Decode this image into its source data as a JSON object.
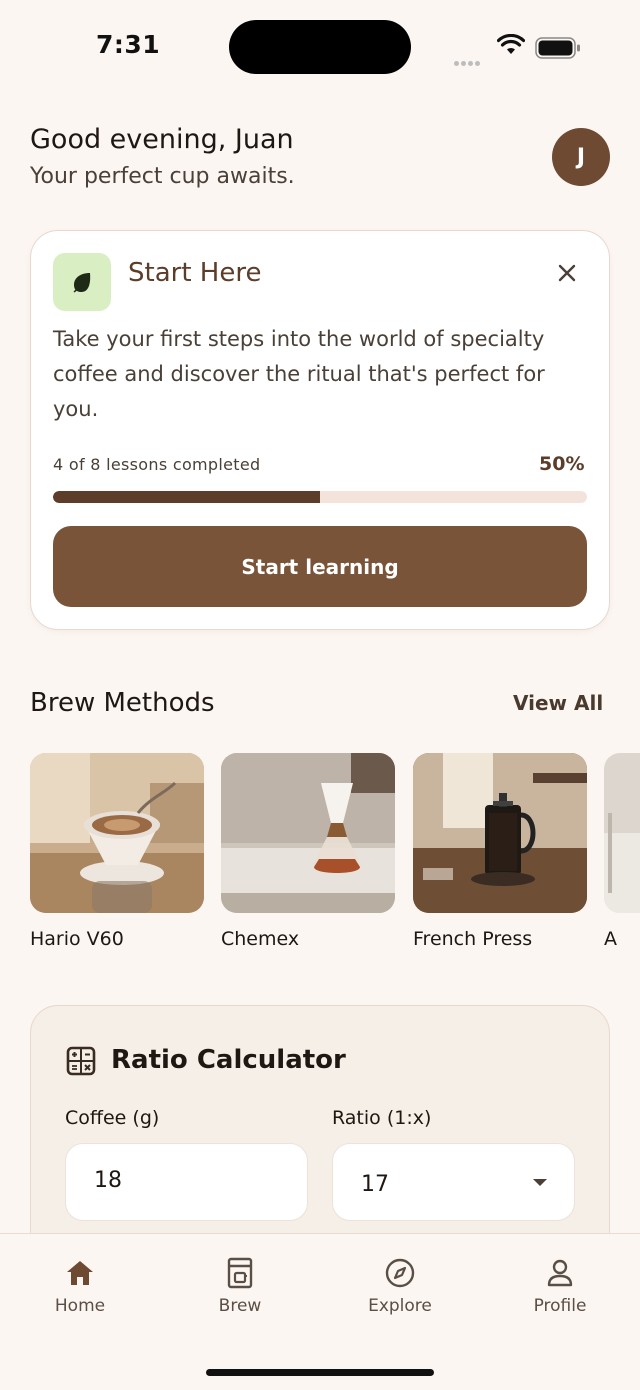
{
  "status_bar": {
    "time": "7:31"
  },
  "header": {
    "greeting": "Good evening, Juan",
    "subtitle": "Your perfect cup awaits.",
    "avatar_initial": "J"
  },
  "start_card": {
    "title": "Start Here",
    "description": "Take your first steps into the world of specialty coffee and discover the ritual that's perfect for you.",
    "progress_label": "4 of 8 lessons completed",
    "progress_percent_label": "50%",
    "progress_value": 0.5,
    "button_label": "Start learning"
  },
  "brew_methods": {
    "title": "Brew Methods",
    "view_all_label": "View All",
    "items": [
      {
        "label": "Hario V60"
      },
      {
        "label": "Chemex"
      },
      {
        "label": "French Press"
      },
      {
        "label": "A"
      }
    ]
  },
  "ratio_calculator": {
    "title": "Ratio Calculator",
    "coffee_label": "Coffee (g)",
    "coffee_value": "18",
    "ratio_label": "Ratio (1:x)",
    "ratio_value": "17"
  },
  "bottom_nav": {
    "items": [
      {
        "label": "Home",
        "icon": "home-icon",
        "active": true
      },
      {
        "label": "Brew",
        "icon": "coffee-maker-icon",
        "active": false
      },
      {
        "label": "Explore",
        "icon": "compass-icon",
        "active": false
      },
      {
        "label": "Profile",
        "icon": "person-icon",
        "active": false
      }
    ]
  },
  "colors": {
    "background": "#fcf6f2",
    "primary_brown": "#7a5438",
    "dark_brown": "#5b3d2a",
    "leaf_bg": "#d9eec3",
    "progress_track": "#f3e3db"
  }
}
